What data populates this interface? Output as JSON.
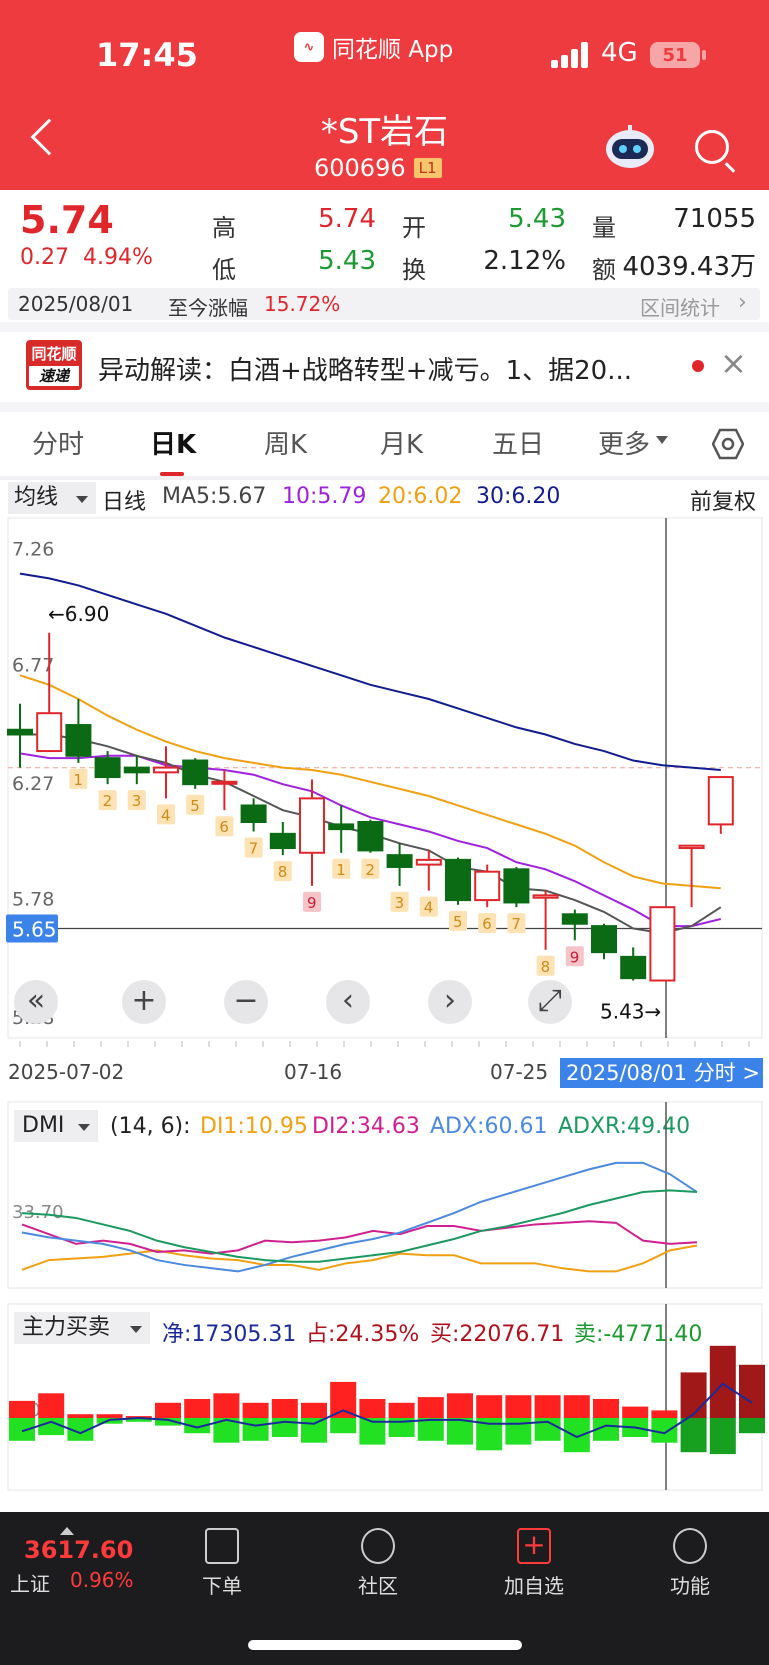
{
  "status_bar": {
    "time": "17:45",
    "app": "同花顺 App",
    "network": "4G",
    "battery": "51"
  },
  "header": {
    "name": "*ST岩石",
    "code": "600696",
    "level": "L1"
  },
  "quote": {
    "price": "5.74",
    "change": "0.27",
    "change_pct": "4.94%",
    "high_label": "高",
    "high": "5.74",
    "open_label": "开",
    "open": "5.43",
    "vol_label": "量",
    "vol": "71055",
    "low_label": "低",
    "low": "5.43",
    "turn_label": "换",
    "turn": "2.12%",
    "amt_label": "额",
    "amt": "4039.43万",
    "date": "2025/08/01",
    "since_label": "至今涨幅",
    "since": "15.72%",
    "interval": "区间统计"
  },
  "news": {
    "logo_top": "同花顺",
    "logo_bottom": "速递",
    "text": "异动解读：白酒+战略转型+减亏。1、据20..."
  },
  "tabs": [
    "分时",
    "日K",
    "周K",
    "月K",
    "五日",
    "更多"
  ],
  "ma": {
    "mode": "均线",
    "period": "日线",
    "ma5": "MA5:5.67",
    "ma10": "10:5.79",
    "ma20": "20:6.02",
    "ma30": "30:6.20",
    "adj": "前复权"
  },
  "colors": {
    "up": "#e0262b",
    "down": "#0a6b14",
    "ma5": "#555555",
    "ma10": "#a020e0",
    "ma20": "#f0a010",
    "ma30": "#101c90"
  },
  "chart_data": {
    "type": "candlestick",
    "y_ticks": [
      "7.26",
      "6.77",
      "6.27",
      "5.78",
      "5.28"
    ],
    "ylim": [
      5.28,
      7.26
    ],
    "current": "5.65",
    "max_label": "←6.90",
    "min_label": "5.43→",
    "x_labels": [
      "2025-07-02",
      "07-16",
      "07-25",
      "2025/08/01 分时 >"
    ],
    "candles": [
      {
        "o": 6.49,
        "c": 6.47,
        "h": 6.6,
        "l": 6.33
      },
      {
        "o": 6.4,
        "c": 6.56,
        "h": 6.9,
        "l": 6.4
      },
      {
        "o": 6.51,
        "c": 6.38,
        "h": 6.62,
        "l": 6.35
      },
      {
        "o": 6.37,
        "c": 6.29,
        "h": 6.4,
        "l": 6.26
      },
      {
        "o": 6.33,
        "c": 6.31,
        "h": 6.38,
        "l": 6.26
      },
      {
        "o": 6.31,
        "c": 6.33,
        "h": 6.42,
        "l": 6.2
      },
      {
        "o": 6.36,
        "c": 6.26,
        "h": 6.37,
        "l": 6.24
      },
      {
        "o": 6.27,
        "c": 6.27,
        "h": 6.32,
        "l": 6.15
      },
      {
        "o": 6.17,
        "c": 6.1,
        "h": 6.2,
        "l": 6.06
      },
      {
        "o": 6.05,
        "c": 5.99,
        "h": 6.1,
        "l": 5.96
      },
      {
        "o": 5.97,
        "c": 6.2,
        "h": 6.28,
        "l": 5.83
      },
      {
        "o": 6.09,
        "c": 6.07,
        "h": 6.17,
        "l": 5.97
      },
      {
        "o": 6.1,
        "c": 5.98,
        "h": 6.11,
        "l": 5.97
      },
      {
        "o": 5.96,
        "c": 5.91,
        "h": 6.01,
        "l": 5.83
      },
      {
        "o": 5.92,
        "c": 5.94,
        "h": 5.98,
        "l": 5.81
      },
      {
        "o": 5.94,
        "c": 5.77,
        "h": 5.95,
        "l": 5.75
      },
      {
        "o": 5.77,
        "c": 5.89,
        "h": 5.92,
        "l": 5.74
      },
      {
        "o": 5.9,
        "c": 5.76,
        "h": 5.91,
        "l": 5.74
      },
      {
        "o": 5.78,
        "c": 5.79,
        "h": 5.81,
        "l": 5.56
      },
      {
        "o": 5.71,
        "c": 5.67,
        "h": 5.73,
        "l": 5.6
      },
      {
        "o": 5.66,
        "c": 5.55,
        "h": 5.67,
        "l": 5.52
      },
      {
        "o": 5.53,
        "c": 5.44,
        "h": 5.57,
        "l": 5.43
      },
      {
        "o": 5.43,
        "c": 5.74,
        "h": 5.74,
        "l": 5.43
      },
      {
        "o": 5.99,
        "c": 6.0,
        "h": 6.0,
        "l": 5.74
      },
      {
        "o": 6.09,
        "c": 6.29,
        "h": 6.29,
        "l": 6.05
      }
    ],
    "signals": [
      {
        "i": 2,
        "t": "1"
      },
      {
        "i": 3,
        "t": "2"
      },
      {
        "i": 4,
        "t": "3"
      },
      {
        "i": 5,
        "t": "4"
      },
      {
        "i": 6,
        "t": "5"
      },
      {
        "i": 7,
        "t": "6"
      },
      {
        "i": 8,
        "t": "7"
      },
      {
        "i": 9,
        "t": "8"
      },
      {
        "i": 10,
        "t": "9"
      },
      {
        "i": 11,
        "t": "1"
      },
      {
        "i": 12,
        "t": "2"
      },
      {
        "i": 13,
        "t": "3"
      },
      {
        "i": 14,
        "t": "4"
      },
      {
        "i": 15,
        "t": "5"
      },
      {
        "i": 16,
        "t": "6"
      },
      {
        "i": 17,
        "t": "7"
      },
      {
        "i": 18,
        "t": "8"
      },
      {
        "i": 19,
        "t": "9"
      }
    ],
    "ma5": [
      6.47,
      6.47,
      6.45,
      6.42,
      6.38,
      6.35,
      6.3,
      6.27,
      6.21,
      6.15,
      6.12,
      6.08,
      6.05,
      6.01,
      5.98,
      5.91,
      5.89,
      5.82,
      5.81,
      5.77,
      5.72,
      5.65,
      5.63,
      5.66,
      5.74
    ],
    "ma10": [
      6.39,
      6.37,
      6.37,
      6.38,
      6.38,
      6.34,
      6.33,
      6.32,
      6.3,
      6.26,
      6.23,
      6.17,
      6.12,
      6.09,
      6.06,
      6.02,
      5.99,
      5.93,
      5.9,
      5.85,
      5.79,
      5.73,
      5.66,
      5.66,
      5.69
    ],
    "ma20": [
      6.72,
      6.68,
      6.62,
      6.55,
      6.49,
      6.44,
      6.4,
      6.37,
      6.35,
      6.33,
      6.32,
      6.3,
      6.27,
      6.24,
      6.21,
      6.17,
      6.13,
      6.09,
      6.05,
      6.0,
      5.93,
      5.87,
      5.84,
      5.83,
      5.82
    ],
    "ma30": [
      7.15,
      7.13,
      7.1,
      7.06,
      7.02,
      6.98,
      6.93,
      6.88,
      6.84,
      6.8,
      6.76,
      6.72,
      6.68,
      6.65,
      6.62,
      6.58,
      6.54,
      6.5,
      6.47,
      6.43,
      6.4,
      6.36,
      6.34,
      6.33,
      6.32
    ]
  },
  "dmi": {
    "name": "DMI",
    "params": "(14, 6):",
    "di1": "DI1:10.95",
    "di2": "DI2:34.63",
    "adx": "ADX:60.61",
    "adxr": "ADXR:49.40",
    "tick": "33.70",
    "di1_series": [
      10,
      16,
      17,
      18,
      20,
      22,
      19,
      17,
      16,
      13,
      13,
      10,
      14,
      16,
      20,
      19,
      19,
      14,
      14,
      14,
      11,
      9,
      9,
      14,
      22,
      25
    ],
    "di2_series": [
      38,
      32,
      26,
      28,
      26,
      21,
      22,
      20,
      22,
      28,
      27,
      28,
      30,
      34,
      32,
      37,
      37,
      34,
      36,
      38,
      39,
      40,
      39,
      28,
      26,
      27
    ],
    "adx_series": [
      33,
      30,
      28,
      26,
      22,
      16,
      13,
      11,
      9,
      13,
      18,
      22,
      26,
      29,
      33,
      39,
      45,
      52,
      57,
      62,
      67,
      72,
      76,
      76,
      69,
      58
    ],
    "adxr_series": [
      45,
      44,
      42,
      38,
      34,
      28,
      24,
      21,
      18,
      16,
      15,
      15,
      17,
      19,
      21,
      25,
      29,
      34,
      37,
      41,
      45,
      50,
      54,
      58,
      59,
      58
    ]
  },
  "mainforce": {
    "name": "主力买卖",
    "net": "净:17305.31",
    "pct": "占:24.35%",
    "buy": "买:22076.71",
    "sell": "卖:-4771.40",
    "tick": "0.00",
    "buy_series": [
      9,
      13,
      2,
      2,
      1,
      8,
      10,
      13,
      8,
      10,
      8,
      19,
      10,
      8,
      11,
      13,
      12,
      12,
      12,
      12,
      10,
      6,
      4,
      24,
      38,
      28
    ],
    "sell_series": [
      -12,
      -9,
      -12,
      -3,
      -2,
      -4,
      -8,
      -13,
      -12,
      -10,
      -13,
      -8,
      -14,
      -10,
      -12,
      -14,
      -17,
      -14,
      -12,
      -18,
      -12,
      -10,
      -13,
      -18,
      -19,
      -8
    ],
    "net_series": [
      -7,
      -2,
      -8,
      -1,
      0,
      -1,
      -5,
      -1,
      -4,
      -2,
      -3,
      4,
      -2,
      -2,
      -1,
      -1,
      -3,
      -3,
      -2,
      -10,
      -4,
      -5,
      -8,
      2,
      18,
      8
    ]
  },
  "chart_controls": [
    "«",
    "+",
    "−",
    "‹",
    "›",
    "⤢"
  ],
  "bottom_nav": {
    "index_value": "3617.60",
    "index_name": "上证",
    "index_pct": "0.96%",
    "items": [
      "下单",
      "社区",
      "加自选",
      "功能"
    ]
  }
}
